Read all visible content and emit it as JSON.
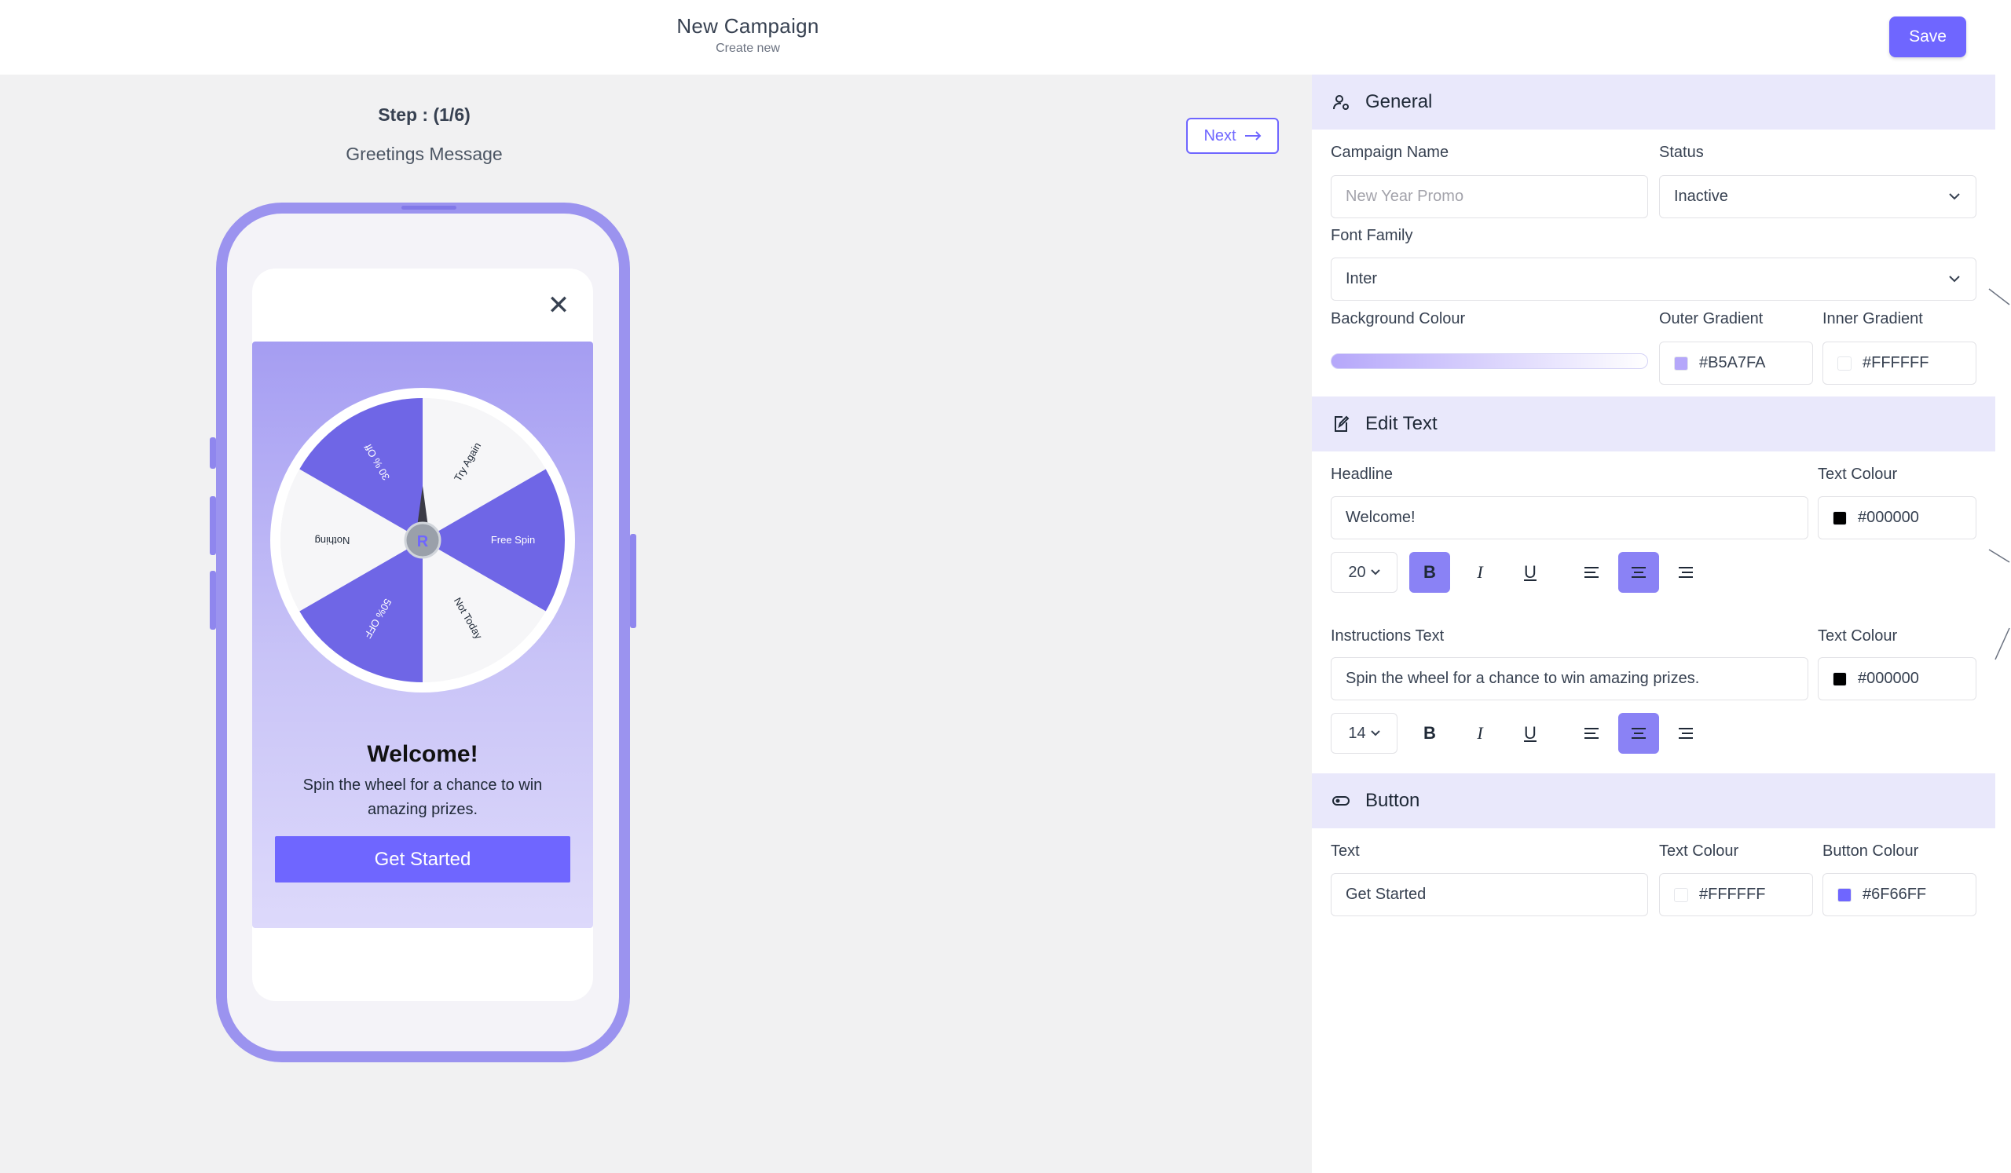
{
  "header": {
    "title": "New Campaign",
    "subtitle": "Create new",
    "save_label": "Save"
  },
  "preview": {
    "step": "Step : (1/6)",
    "step_name": "Greetings Message",
    "next_label": "Next",
    "close_glyph": "✕",
    "headline": "Welcome!",
    "instructions": "Spin the wheel for a chance to win amazing prizes.",
    "button_label": "Get Started",
    "wheel_segments": [
      "Try Again",
      "Free Spin",
      "Not Today",
      "50% OFF",
      "Nothing",
      "30 % Off"
    ]
  },
  "general": {
    "title": "General",
    "campaign_name_label": "Campaign Name",
    "campaign_name_placeholder": "New Year Promo",
    "status_label": "Status",
    "status_value": "Inactive",
    "font_family_label": "Font Family",
    "font_family_value": "Inter",
    "bg_colour_label": "Background Colour",
    "outer_gradient_label": "Outer Gradient",
    "outer_gradient_value": "#B5A7FA",
    "inner_gradient_label": "Inner Gradient",
    "inner_gradient_value": "#FFFFFF"
  },
  "edit_text": {
    "title": "Edit Text",
    "headline_label": "Headline",
    "headline_value": "Welcome!",
    "headline_colour_label": "Text Colour",
    "headline_colour_value": "#000000",
    "headline_size": "20",
    "instructions_label": "Instructions Text",
    "instructions_value": "Spin the wheel for a chance to win amazing prizes.",
    "instructions_colour_label": "Text Colour",
    "instructions_colour_value": "#000000",
    "instructions_size": "14",
    "bold_glyph": "B",
    "italic_glyph": "I",
    "underline_glyph": "U"
  },
  "button_section": {
    "title": "Button",
    "text_label": "Text",
    "text_value": "Get Started",
    "text_colour_label": "Text Colour",
    "text_colour_value": "#FFFFFF",
    "button_colour_label": "Button Colour",
    "button_colour_value": "#6F66FF"
  },
  "colors": {
    "accent": "#6F66FF",
    "wheel_purple": "#6F66E6",
    "section_bg": "#E9E8FB"
  }
}
